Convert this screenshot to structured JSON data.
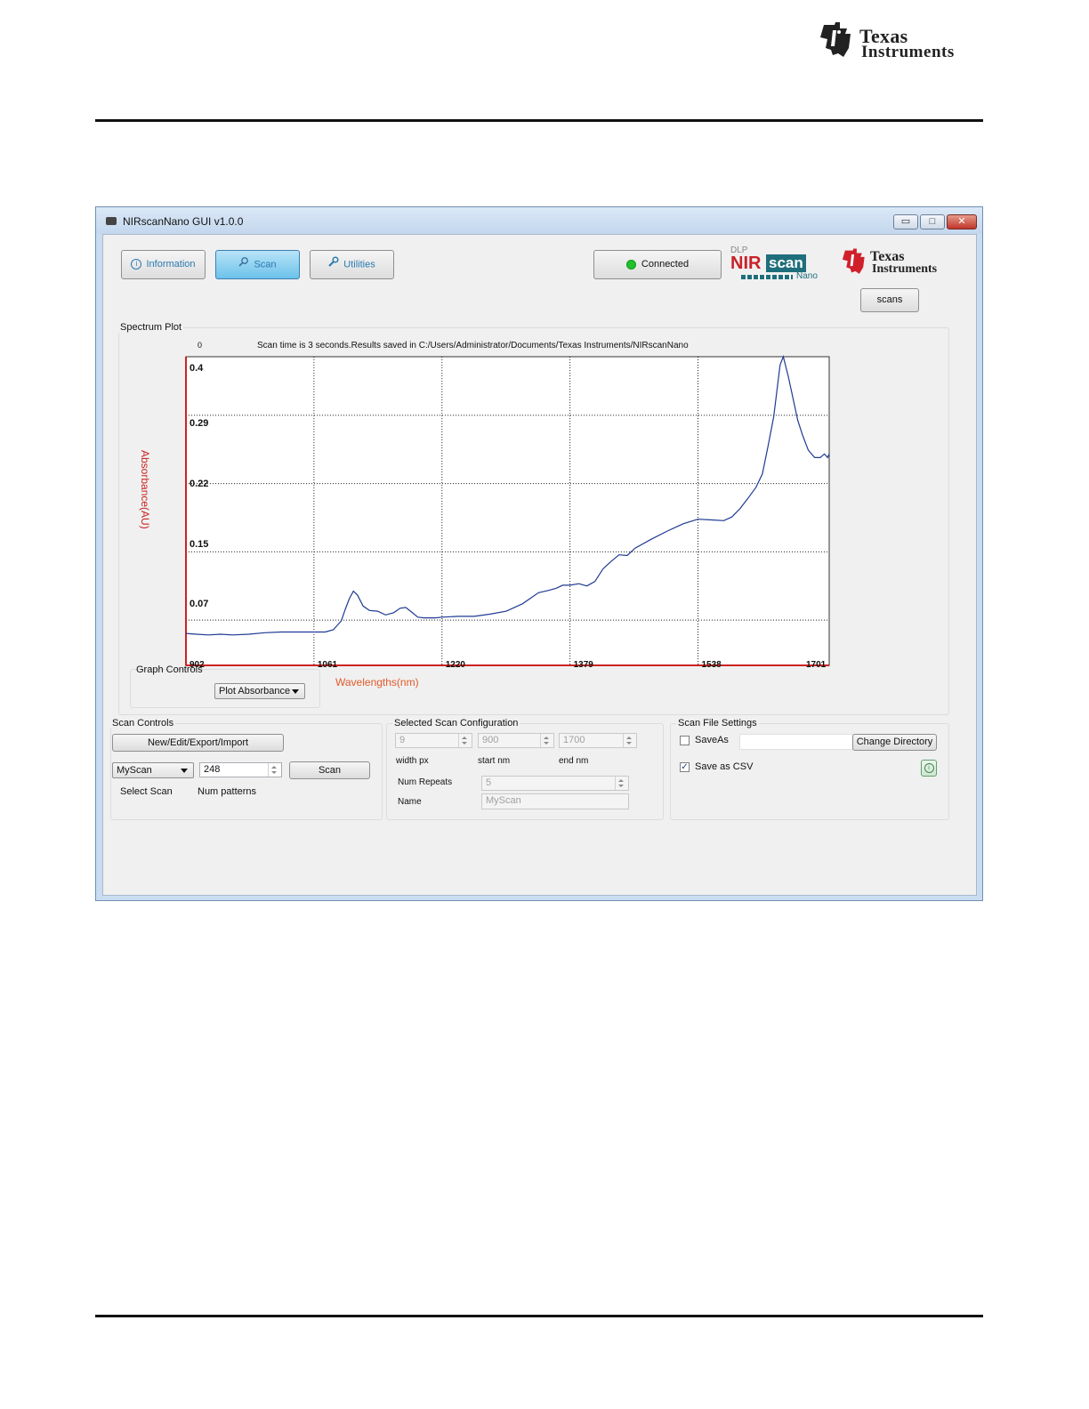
{
  "page": {
    "logo_line1": "Texas",
    "logo_line2": "Instruments"
  },
  "window": {
    "title": "NIRscanNano GUI v1.0.0",
    "controls": {
      "minimize": "▭",
      "maximize": "□",
      "close": "✕"
    }
  },
  "toolbar": {
    "tabs": [
      {
        "label": "Information",
        "icon": "info-icon"
      },
      {
        "label": "Scan",
        "icon": "search-icon",
        "active": true
      },
      {
        "label": "Utilities",
        "icon": "wrench-icon"
      }
    ],
    "status_label": "Connected",
    "status_color": "#22c22a",
    "brand_dlp": "DLP",
    "brand_nir": "NIR",
    "brand_scan": "scan",
    "brand_nano": "Nano",
    "ti_line1": "Texas",
    "ti_line2": "Instruments",
    "scans_button": "scans"
  },
  "spectrum_plot": {
    "group_title": "Spectrum Plot",
    "corner_label": "0",
    "message": "Scan time is 3 seconds.Results saved in C:/Users/Administrator/Documents/Texas Instruments/NIRscanNano"
  },
  "chart_data": {
    "type": "line",
    "xlabel": "Wavelengths(nm)",
    "ylabel": "Absorbance(AU)",
    "x_ticks": [
      902,
      1061,
      1220,
      1379,
      1538,
      1701
    ],
    "y_ticks": [
      0.4,
      0.29,
      0.22,
      0.15,
      0.07
    ],
    "xlim": [
      902,
      1701
    ],
    "ylim": [
      0.0,
      0.416
    ],
    "grid": true,
    "line_color": "#1f3a93",
    "axis_color": "#cc2222",
    "label_color": "#e05a2a",
    "series": [
      {
        "x": [
          902,
          915,
          930,
          945,
          960,
          980,
          1000,
          1020,
          1040,
          1061,
          1075,
          1085,
          1095,
          1100,
          1105,
          1110,
          1115,
          1122,
          1130,
          1140,
          1150,
          1160,
          1168,
          1175,
          1182,
          1190,
          1198,
          1205,
          1212,
          1220,
          1240,
          1260,
          1280,
          1300,
          1320,
          1340,
          1352,
          1362,
          1370,
          1379,
          1390,
          1400,
          1410,
          1420,
          1430,
          1440,
          1450,
          1460,
          1480,
          1500,
          1520,
          1538,
          1555,
          1570,
          1580,
          1590,
          1600,
          1610,
          1618,
          1625,
          1632,
          1636,
          1640,
          1644,
          1650,
          1656,
          1662,
          1668,
          1675,
          1683,
          1690,
          1695,
          1699,
          1701
        ],
        "y": [
          0.043,
          0.042,
          0.041,
          0.042,
          0.041,
          0.042,
          0.044,
          0.045,
          0.045,
          0.045,
          0.045,
          0.048,
          0.06,
          0.076,
          0.09,
          0.1,
          0.095,
          0.08,
          0.074,
          0.073,
          0.068,
          0.071,
          0.077,
          0.078,
          0.072,
          0.065,
          0.064,
          0.064,
          0.064,
          0.065,
          0.066,
          0.066,
          0.069,
          0.073,
          0.083,
          0.098,
          0.101,
          0.104,
          0.108,
          0.108,
          0.11,
          0.107,
          0.113,
          0.13,
          0.14,
          0.149,
          0.148,
          0.158,
          0.17,
          0.181,
          0.191,
          0.197,
          0.196,
          0.195,
          0.2,
          0.211,
          0.225,
          0.24,
          0.258,
          0.295,
          0.335,
          0.37,
          0.405,
          0.416,
          0.39,
          0.36,
          0.33,
          0.31,
          0.29,
          0.28,
          0.28,
          0.285,
          0.28,
          0.285
        ]
      }
    ]
  },
  "graph_controls": {
    "group_title": "Graph Controls",
    "plot_mode": "Plot Absorbance"
  },
  "scan_controls": {
    "group_title": "Scan Controls",
    "config_button": "New/Edit/Export/Import",
    "selected_scan": "MyScan",
    "num_patterns": "248",
    "scan_button": "Scan",
    "select_scan_label": "Select Scan",
    "num_patterns_label": "Num patterns"
  },
  "scan_config": {
    "group_title": "Selected Scan Configuration",
    "width_px": "9",
    "start_nm": "900",
    "end_nm": "1700",
    "width_px_label": "width px",
    "start_nm_label": "start nm",
    "end_nm_label": "end nm",
    "num_repeats_label": "Num Repeats",
    "num_repeats": "5",
    "name_label": "Name",
    "name": "MyScan"
  },
  "scan_file_settings": {
    "group_title": "Scan File Settings",
    "save_as_label": "SaveAs",
    "save_as_checked": false,
    "save_as_path": "",
    "change_directory_button": "Change Directory",
    "save_csv_label": "Save as CSV",
    "save_csv_checked": true
  }
}
